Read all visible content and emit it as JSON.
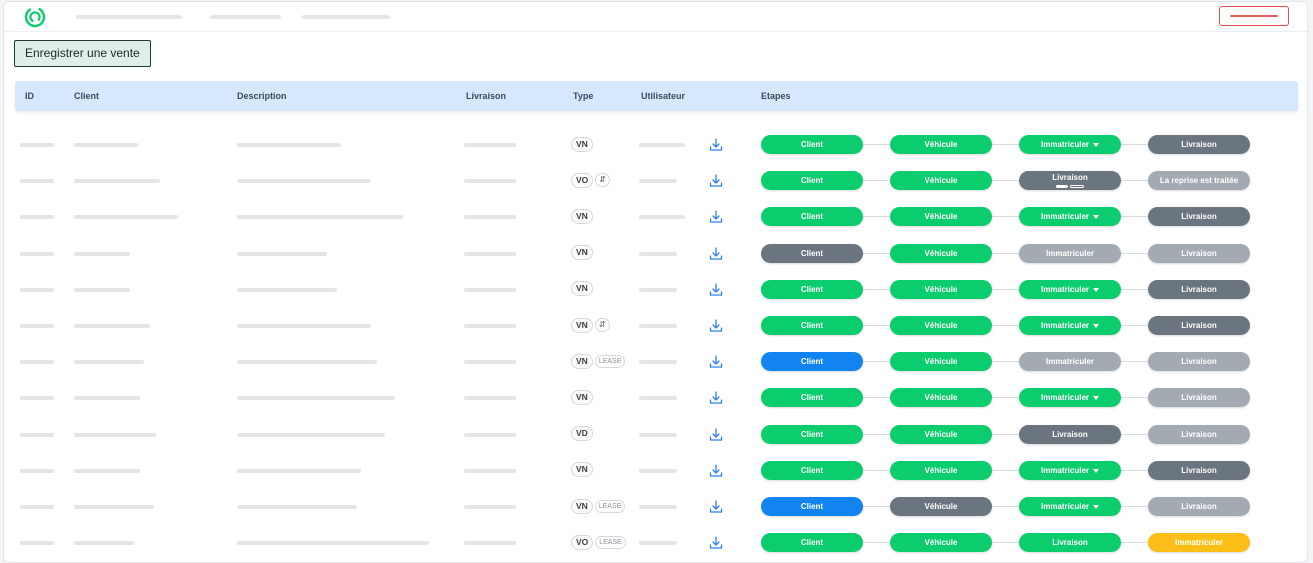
{
  "app": {
    "sale_button_label": "Enregistrer une vente"
  },
  "table": {
    "headers": {
      "id": "ID",
      "client": "Client",
      "description": "Description",
      "livraison": "Livraison",
      "type": "Type",
      "utilisateur": "Utilisateur",
      "etapes": "Etapes"
    },
    "rows": [
      {
        "type": "VN",
        "tag": "",
        "steps": [
          {
            "label": "Client",
            "state": "green"
          },
          {
            "label": "Véhicule",
            "state": "green"
          },
          {
            "label": "Immatriculer",
            "state": "green",
            "dropdown": true
          },
          {
            "label": "Livraison",
            "state": "dark"
          }
        ]
      },
      {
        "type": "VO",
        "tag": "swap",
        "steps": [
          {
            "label": "Client",
            "state": "green"
          },
          {
            "label": "Véhicule",
            "state": "green"
          },
          {
            "label": "Livraison",
            "state": "dark",
            "progress": true
          },
          {
            "label": "La reprise est traitée",
            "state": "light"
          }
        ]
      },
      {
        "type": "VN",
        "tag": "",
        "steps": [
          {
            "label": "Client",
            "state": "green"
          },
          {
            "label": "Véhicule",
            "state": "green"
          },
          {
            "label": "Immatriculer",
            "state": "green",
            "dropdown": true
          },
          {
            "label": "Livraison",
            "state": "dark"
          }
        ]
      },
      {
        "type": "VN",
        "tag": "",
        "steps": [
          {
            "label": "Client",
            "state": "dark"
          },
          {
            "label": "Véhicule",
            "state": "green"
          },
          {
            "label": "Immatriculer",
            "state": "light"
          },
          {
            "label": "Livraison",
            "state": "light"
          }
        ]
      },
      {
        "type": "VN",
        "tag": "",
        "steps": [
          {
            "label": "Client",
            "state": "green"
          },
          {
            "label": "Véhicule",
            "state": "green"
          },
          {
            "label": "Immatriculer",
            "state": "green",
            "dropdown": true
          },
          {
            "label": "Livraison",
            "state": "dark"
          }
        ]
      },
      {
        "type": "VN",
        "tag": "swap",
        "steps": [
          {
            "label": "Client",
            "state": "green"
          },
          {
            "label": "Véhicule",
            "state": "green"
          },
          {
            "label": "Immatriculer",
            "state": "green",
            "dropdown": true
          },
          {
            "label": "Livraison",
            "state": "dark"
          }
        ]
      },
      {
        "type": "VN",
        "tag": "LEASE",
        "steps": [
          {
            "label": "Client",
            "state": "blue"
          },
          {
            "label": "Véhicule",
            "state": "green"
          },
          {
            "label": "Immatriculer",
            "state": "light"
          },
          {
            "label": "Livraison",
            "state": "light"
          }
        ]
      },
      {
        "type": "VN",
        "tag": "",
        "steps": [
          {
            "label": "Client",
            "state": "green"
          },
          {
            "label": "Véhicule",
            "state": "green"
          },
          {
            "label": "Immatriculer",
            "state": "green",
            "dropdown": true
          },
          {
            "label": "Livraison",
            "state": "light"
          }
        ]
      },
      {
        "type": "VD",
        "tag": "",
        "steps": [
          {
            "label": "Client",
            "state": "green"
          },
          {
            "label": "Véhicule",
            "state": "green"
          },
          {
            "label": "Livraison",
            "state": "dark"
          },
          {
            "label": "Livraison",
            "state": "light"
          }
        ]
      },
      {
        "type": "VN",
        "tag": "",
        "steps": [
          {
            "label": "Client",
            "state": "green"
          },
          {
            "label": "Véhicule",
            "state": "green"
          },
          {
            "label": "Immatriculer",
            "state": "green",
            "dropdown": true
          },
          {
            "label": "Livraison",
            "state": "dark"
          }
        ]
      },
      {
        "type": "VN",
        "tag": "LEASE",
        "steps": [
          {
            "label": "Client",
            "state": "blue"
          },
          {
            "label": "Véhicule",
            "state": "dark"
          },
          {
            "label": "Immatriculer",
            "state": "green",
            "dropdown": true
          },
          {
            "label": "Livraison",
            "state": "light"
          }
        ]
      },
      {
        "type": "VO",
        "tag": "LEASE",
        "steps": [
          {
            "label": "Client",
            "state": "green"
          },
          {
            "label": "Véhicule",
            "state": "green"
          },
          {
            "label": "Livraison",
            "state": "green"
          },
          {
            "label": "Immatriculer",
            "state": "yellow"
          }
        ]
      }
    ]
  },
  "icons": {
    "logo": "brand-logo-icon",
    "download": "download-icon",
    "swap": "swap-arrows-icon",
    "dropdown": "caret-down-icon"
  },
  "colors": {
    "step_done": "#0bcd6d",
    "step_current": "#6b7580",
    "step_pending": "#a4aab1",
    "step_active": "#1184f2",
    "step_warning": "#fbbf17",
    "header_bg": "#d6e8fc",
    "logout_border": "#e74c4c"
  }
}
